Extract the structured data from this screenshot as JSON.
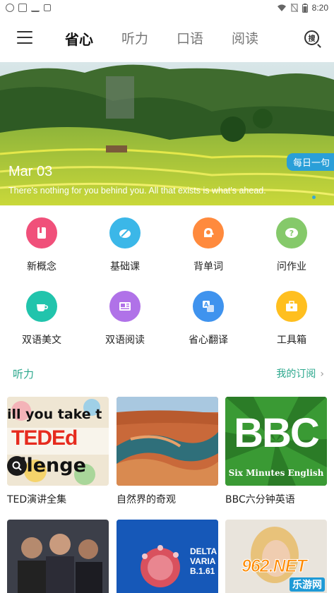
{
  "status_bar": {
    "time": "8:20"
  },
  "nav": {
    "tabs": [
      {
        "label": "省心",
        "active": true
      },
      {
        "label": "听力",
        "active": false
      },
      {
        "label": "口语",
        "active": false
      },
      {
        "label": "阅读",
        "active": false
      }
    ],
    "search_glyph": "搜"
  },
  "banner": {
    "date": "Mar 03",
    "tag": "每日一句",
    "quote": "There's nothing for you behind you. All that exists is what's ahead."
  },
  "features": [
    {
      "label": "新概念",
      "icon": "book-icon",
      "color": "#f0507a"
    },
    {
      "label": "基础课",
      "icon": "pen-paper-icon",
      "color": "#3bb7e8"
    },
    {
      "label": "背单词",
      "icon": "head-brain-icon",
      "color": "#ff8a3d"
    },
    {
      "label": "问作业",
      "icon": "question-cloud-icon",
      "color": "#85c96a"
    },
    {
      "label": "双语美文",
      "icon": "coffee-cup-icon",
      "color": "#21c4ac"
    },
    {
      "label": "双语阅读",
      "icon": "newspaper-icon",
      "color": "#b072e8"
    },
    {
      "label": "省心翻译",
      "icon": "translate-icon",
      "color": "#3f93ee"
    },
    {
      "label": "工具箱",
      "icon": "toolbox-icon",
      "color": "#ffbf1f"
    }
  ],
  "section": {
    "title": "听力",
    "link": "我的订阅",
    "chevron": "›"
  },
  "cards": [
    {
      "caption": "TED演讲全集",
      "thumb_text": [
        "ill you take t",
        "TEDEd",
        "allenge"
      ]
    },
    {
      "caption": "自然界的奇观"
    },
    {
      "caption": "BBC六分钟英语",
      "thumb_text": [
        "BBC",
        "Six Minutes English"
      ]
    },
    {
      "caption": ""
    },
    {
      "caption": "",
      "thumb_text": [
        "DELTA",
        "VARIA",
        "B.1.61"
      ]
    },
    {
      "caption": ""
    }
  ],
  "watermark": {
    "text": "962.NET",
    "sub": "乐游网"
  }
}
